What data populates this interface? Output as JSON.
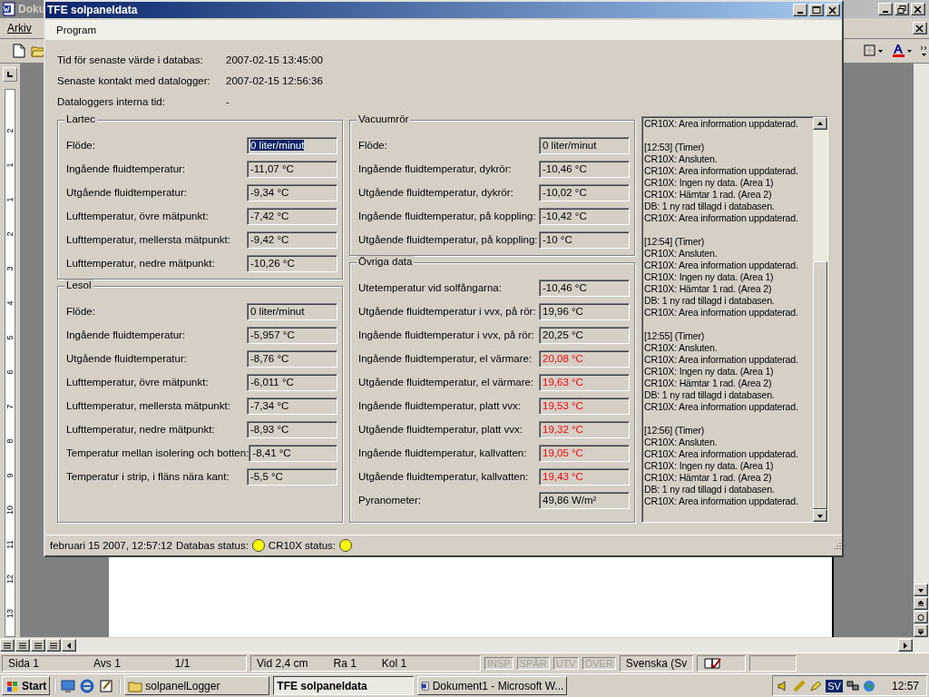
{
  "background_window": {
    "title": "Doku",
    "menu": [
      "Arkiv"
    ],
    "ruler_numbers": [
      "2",
      "1",
      "1",
      "2",
      "3",
      "4",
      "5",
      "6",
      "7",
      "8",
      "9",
      "10",
      "11",
      "12",
      "13"
    ],
    "status_bar": {
      "cells": [
        "Sida 1",
        "Avs 1",
        "1/1",
        "Vid 2,4 cm",
        "Ra 1",
        "Kol 1"
      ],
      "modes": [
        {
          "label": "INSP",
          "on": false
        },
        {
          "label": "SPÅR",
          "on": false
        },
        {
          "label": "UTV",
          "on": false
        },
        {
          "label": "ÖVER",
          "on": false
        }
      ],
      "language": "Svenska (Sv"
    }
  },
  "window": {
    "title": "TFE solpaneldata",
    "menu": [
      "Program"
    ],
    "info": [
      {
        "label": "Tid för senaste värde i databas:",
        "value": "2007-02-15 13:45:00"
      },
      {
        "label": "Senaste kontakt med datalogger:",
        "value": "2007-02-15 12:56:36"
      },
      {
        "label": "Dataloggers interna tid:",
        "value": "-"
      }
    ],
    "columns": [
      [
        {
          "title": "Lartec",
          "rows": [
            {
              "label": "Flöde:",
              "value": "0 liter/minut",
              "warning": false,
              "focused": true
            },
            {
              "label": "Ingående fluidtemperatur:",
              "value": "-11,07 °C",
              "warning": false,
              "focused": false
            },
            {
              "label": "Utgående fluidtemperatur:",
              "value": "-9,34 °C",
              "warning": false,
              "focused": false
            },
            {
              "label": "Lufttemperatur, övre mätpunkt:",
              "value": "-7,42 °C",
              "warning": false,
              "focused": false
            },
            {
              "label": "Lufttemperatur, mellersta mätpunkt:",
              "value": "-9,42 °C",
              "warning": false,
              "focused": false
            },
            {
              "label": "Lufttemperatur, nedre mätpunkt:",
              "value": "-10,26 °C",
              "warning": false,
              "focused": false
            }
          ]
        },
        {
          "title": "Lesol",
          "rows": [
            {
              "label": "Flöde:",
              "value": "0 liter/minut",
              "warning": false,
              "focused": false
            },
            {
              "label": "Ingående fluidtemperatur:",
              "value": "-5,957 °C",
              "warning": false,
              "focused": false
            },
            {
              "label": "Utgående fluidtemperatur:",
              "value": "-8,76 °C",
              "warning": false,
              "focused": false
            },
            {
              "label": "Lufttemperatur, övre mätpunkt:",
              "value": "-6,011 °C",
              "warning": false,
              "focused": false
            },
            {
              "label": "Lufttemperatur, mellersta mätpunkt:",
              "value": "-7,34 °C",
              "warning": false,
              "focused": false
            },
            {
              "label": "Lufttemperatur, nedre mätpunkt:",
              "value": "-8,93 °C",
              "warning": false,
              "focused": false
            },
            {
              "label": "Temperatur mellan isolering och botten:",
              "value": "-8,41 °C",
              "warning": false,
              "focused": false
            },
            {
              "label": "Temperatur i strip, i fläns nära kant:",
              "value": "-5,5 °C",
              "warning": false,
              "focused": false
            }
          ]
        }
      ],
      [
        {
          "title": "Vacuumrör",
          "rows": [
            {
              "label": "Flöde:",
              "value": "0 liter/minut",
              "warning": false,
              "focused": false
            },
            {
              "label": "Ingående fluidtemperatur, dykrör:",
              "value": "-10,46 °C",
              "warning": false,
              "focused": false
            },
            {
              "label": "Utgående fluidtemperatur, dykrör:",
              "value": "-10,02 °C",
              "warning": false,
              "focused": false
            },
            {
              "label": "Ingående fluidtemperatur, på koppling:",
              "value": "-10,42 °C",
              "warning": false,
              "focused": false
            },
            {
              "label": "Utgående fluidtemperatur, på koppling:",
              "value": "-10 °C",
              "warning": false,
              "focused": false
            }
          ]
        },
        {
          "title": "Övriga data",
          "rows": [
            {
              "label": "Utetemperatur vid solfångarna:",
              "value": "-10,46 °C",
              "warning": false,
              "focused": false
            },
            {
              "label": "Utgående fluidtemperatur i vvx, på rör:",
              "value": "19,96 °C",
              "warning": false,
              "focused": false
            },
            {
              "label": "Ingående fluidtemperatur i vvx, på rör:",
              "value": "20,25 °C",
              "warning": false,
              "focused": false
            },
            {
              "label": "Ingående fluidtemperatur, el värmare:",
              "value": "20,08 °C",
              "warning": true,
              "focused": false
            },
            {
              "label": "Utgående fluidtemperatur, el värmare:",
              "value": "19,63 °C",
              "warning": true,
              "focused": false
            },
            {
              "label": "Ingående fluidtemperatur, platt vvx:",
              "value": "19,53 °C",
              "warning": true,
              "focused": false
            },
            {
              "label": "Utgående fluidtemperatur, platt vvx:",
              "value": "19,32 °C",
              "warning": true,
              "focused": false
            },
            {
              "label": "Ingående fluidtemperatur, kallvatten:",
              "value": "19,05 °C",
              "warning": true,
              "focused": false
            },
            {
              "label": "Utgående fluidtemperatur, kallvatten:",
              "value": "19,43 °C",
              "warning": true,
              "focused": false
            },
            {
              "label": "Pyranometer:",
              "value": "49,86 W/m²",
              "warning": false,
              "focused": false
            }
          ]
        }
      ]
    ],
    "log": [
      [
        "CR10X: Area information uppdaterad."
      ],
      [
        "[12:53] (Timer)",
        "CR10X: Ansluten.",
        "CR10X: Area information uppdaterad.",
        "CR10X: Ingen ny data. (Area 1)",
        "CR10X: Hämtar 1 rad. (Area 2)",
        "DB: 1 ny rad tillagd i databasen.",
        "CR10X: Area information uppdaterad."
      ],
      [
        "[12:54] (Timer)",
        "CR10X: Ansluten.",
        "CR10X: Area information uppdaterad.",
        "CR10X: Ingen ny data. (Area 1)",
        "CR10X: Hämtar 1 rad. (Area 2)",
        "DB: 1 ny rad tillagd i databasen.",
        "CR10X: Area information uppdaterad."
      ],
      [
        "[12:55] (Timer)",
        "CR10X: Ansluten.",
        "CR10X: Area information uppdaterad.",
        "CR10X: Ingen ny data. (Area 1)",
        "CR10X: Hämtar 1 rad. (Area 2)",
        "DB: 1 ny rad tillagd i databasen.",
        "CR10X: Area information uppdaterad."
      ],
      [
        "[12:56] (Timer)",
        "CR10X: Ansluten.",
        "CR10X: Area information uppdaterad.",
        "CR10X: Ingen ny data. (Area 1)",
        "CR10X: Hämtar 1 rad. (Area 2)",
        "DB: 1 ny rad tillagd i databasen.",
        "CR10X: Area information uppdaterad."
      ]
    ],
    "status_bar": {
      "datetime": "februari 15 2007, 12:57:12",
      "indicators": [
        {
          "label": "Databas status:",
          "color": "#ffff00"
        },
        {
          "label": "CR10X status:",
          "color": "#ffff00"
        }
      ]
    }
  },
  "taskbar": {
    "start": "Start",
    "tasks": [
      {
        "label": "solpanelLogger",
        "selected": false
      },
      {
        "label": "TFE solpaneldata",
        "selected": true
      },
      {
        "label": "Dokument1 - Microsoft W...",
        "selected": false
      }
    ],
    "tray": {
      "language": "SV",
      "clock": "12:57"
    }
  }
}
